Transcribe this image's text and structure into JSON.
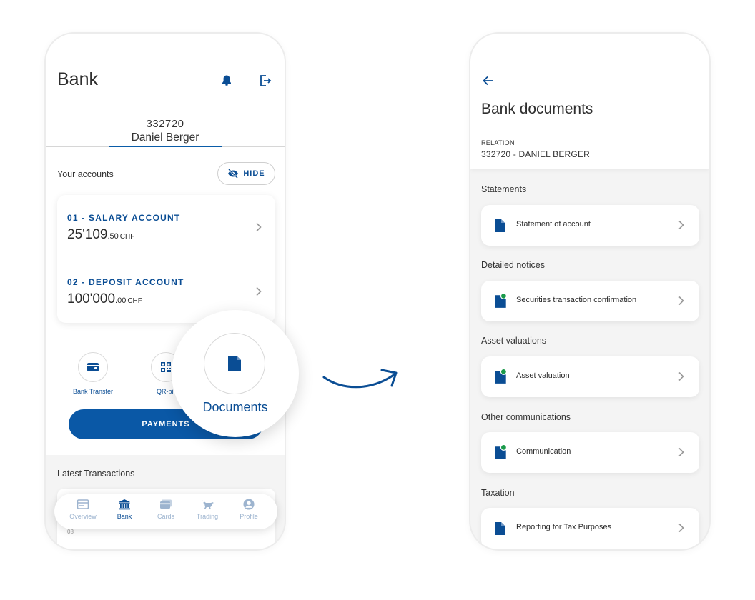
{
  "left_screen": {
    "header": {
      "title": "Bank"
    },
    "relation": {
      "number": "332720",
      "name": "Daniel Berger"
    },
    "accounts_section": {
      "label": "Your accounts",
      "hide_label": "HIDE"
    },
    "accounts": [
      {
        "name": "01 - SALARY ACCOUNT",
        "amount_int": "25'109",
        "amount_dec": ".50",
        "currency": "CHF"
      },
      {
        "name": "02 - DEPOSIT ACCOUNT",
        "amount_int": "100'000",
        "amount_dec": ".00",
        "currency": "CHF"
      }
    ],
    "quick_actions": [
      {
        "label": "Bank Transfer",
        "icon": "wallet-icon"
      },
      {
        "label": "QR-bi",
        "icon": "qr-code-icon"
      }
    ],
    "payments_label": "PAYMENTS",
    "latest_transactions": {
      "label": "Latest Transactions",
      "peek_text": "08"
    },
    "tabbar": [
      {
        "label": "Overview",
        "icon": "overview-icon",
        "active": false
      },
      {
        "label": "Bank",
        "icon": "bank-icon",
        "active": true
      },
      {
        "label": "Cards",
        "icon": "cards-icon",
        "active": false
      },
      {
        "label": "Trading",
        "icon": "bull-icon",
        "active": false
      },
      {
        "label": "Profile",
        "icon": "profile-icon",
        "active": false
      }
    ]
  },
  "zoom": {
    "label": "Documents",
    "icon": "document-icon"
  },
  "right_screen": {
    "header": {
      "title": "Bank documents"
    },
    "relation": {
      "label": "RELATION",
      "value": "332720 - DANIEL BERGER"
    },
    "sections": [
      {
        "title": "Statements",
        "item": "Statement of account",
        "icon": "document-icon"
      },
      {
        "title": "Detailed notices",
        "item": "Securities transaction confirmation",
        "icon": "document-badge-icon"
      },
      {
        "title": "Asset valuations",
        "item": "Asset valuation",
        "icon": "document-badge-icon"
      },
      {
        "title": "Other communications",
        "item": "Communication",
        "icon": "document-badge-icon"
      },
      {
        "title": "Taxation",
        "item": "Reporting for Tax Purposes",
        "icon": "document-icon"
      }
    ]
  },
  "colors": {
    "primary": "#0a58a6",
    "primary_text": "#0a4d94",
    "badge_green": "#1a9a4a",
    "background": "#f4f4f4"
  }
}
